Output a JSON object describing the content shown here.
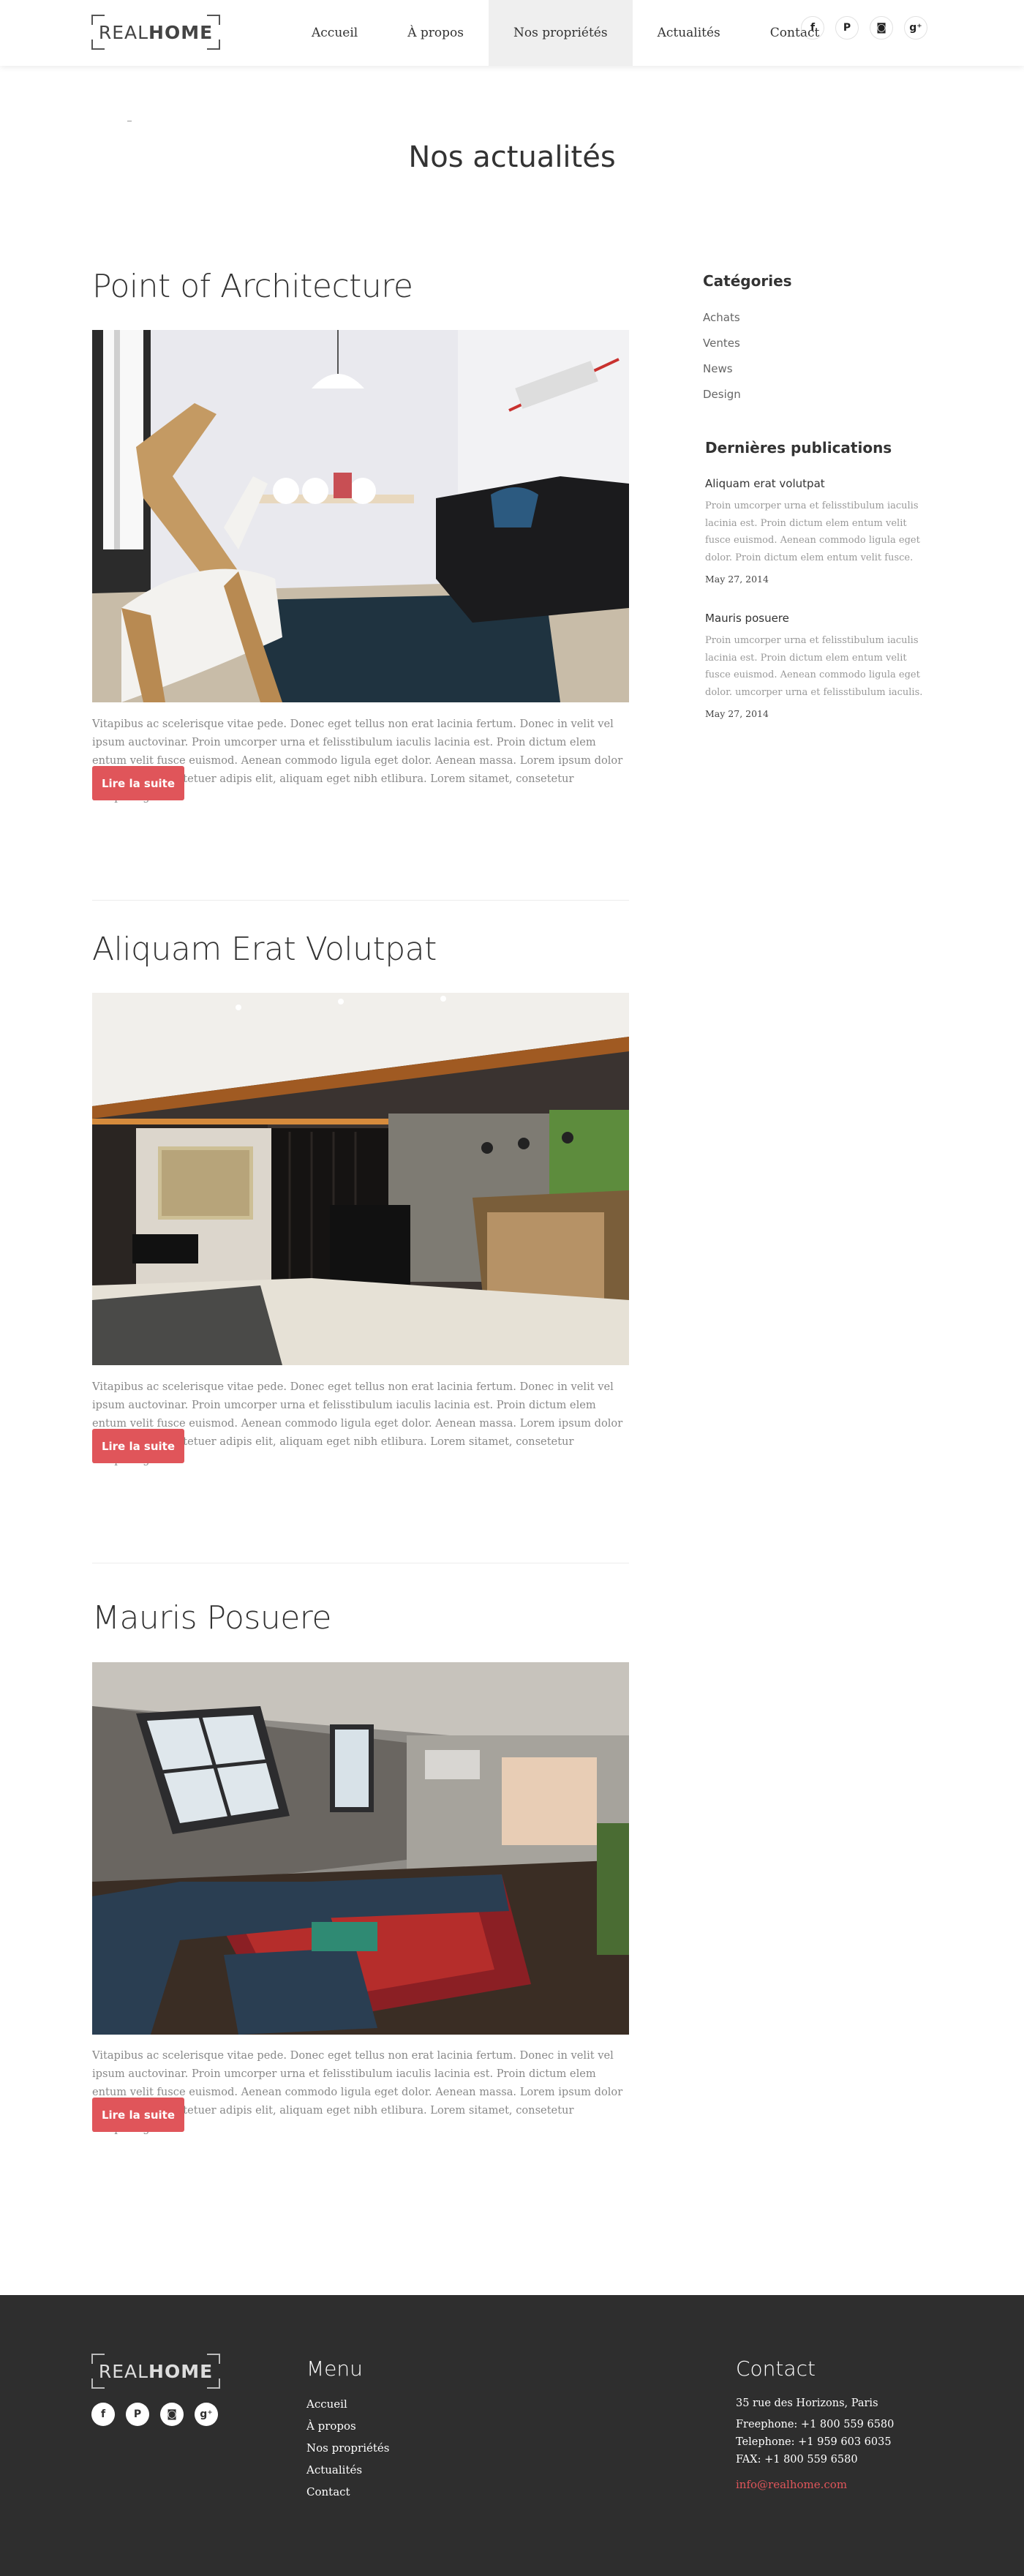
{
  "header": {
    "logo": {
      "light": "REAL",
      "bold": "HOME"
    },
    "nav": [
      "Accueil",
      "À propos",
      "Nos propriétés",
      "Actualités",
      "Contact"
    ],
    "active_nav": "Nos propriétés",
    "social": [
      {
        "icon": "facebook-icon",
        "glyph": "f"
      },
      {
        "icon": "pinterest-icon",
        "glyph": "P"
      },
      {
        "icon": "instagram-icon",
        "glyph": "◙"
      },
      {
        "icon": "google-plus-icon",
        "glyph": "g⁺"
      }
    ]
  },
  "page_title": "Nos actualités",
  "posts": [
    {
      "title": "Point of Architecture",
      "text": "Vitapibus ac scelerisque vitae pede. Donec eget tellus non erat lacinia fertum. Donec in velit vel ipsum auctovinar. Proin umcorper urna et felisstibulum iaculis lacinia est. Proin dictum elem entum velit fusce euismod. Aenean commodo ligula eget dolor. Aenean massa. Lorem ipsum dolor sit amet, consec tetuer adipis elit, aliquam eget nibh etlibura. Lorem sitamet, consetetur sadipscing elitr.",
      "button": "Lire la suite"
    },
    {
      "title": "Aliquam Erat Volutpat",
      "text": "Vitapibus ac scelerisque vitae pede. Donec eget tellus non erat lacinia fertum. Donec in velit vel ipsum auctovinar. Proin umcorper urna et felisstibulum iaculis lacinia est. Proin dictum elem entum velit fusce euismod. Aenean commodo ligula eget dolor. Aenean massa. Lorem ipsum dolor sit amet, consec tetuer adipis elit, aliquam eget nibh etlibura. Lorem sitamet, consetetur sadipscing elitr.",
      "button": "Lire la suite"
    },
    {
      "title": "Mauris Posuere",
      "text": "Vitapibus ac scelerisque vitae pede. Donec eget tellus non erat lacinia fertum. Donec in velit vel ipsum auctovinar. Proin umcorper urna et felisstibulum iaculis lacinia est. Proin dictum elem entum velit fusce euismod. Aenean commodo ligula eget dolor. Aenean massa. Lorem ipsum dolor sit amet, consec tetuer adipis elit, aliquam eget nibh etlibura. Lorem sitamet, consetetur sadipscing elitr.",
      "button": "Lire la suite"
    }
  ],
  "sidebar": {
    "categories_title": "Catégories",
    "categories": [
      "Achats",
      "Ventes",
      "News",
      "Design"
    ],
    "recent_title": "Dernières publications",
    "recent": [
      {
        "title": "Aliquam erat volutpat",
        "text": "Proin umcorper urna et felisstibulum iaculis lacinia est. Proin dictum elem entum velit fusce euismod. Aenean commodo ligula eget dolor. Proin dictum elem entum velit fusce.",
        "date": "May 27, 2014"
      },
      {
        "title": "Mauris posuere",
        "text": "Proin umcorper urna et felisstibulum iaculis lacinia est. Proin dictum elem entum velit fusce euismod. Aenean commodo ligula eget dolor. umcorper urna et felisstibulum iaculis.",
        "date": "May 27, 2014"
      }
    ]
  },
  "footer": {
    "logo": {
      "light": "REAL",
      "bold": "HOME"
    },
    "menu_title": "Menu",
    "menu": [
      "Accueil",
      "À propos",
      "Nos propriétés",
      "Actualités",
      "Contact"
    ],
    "contact_title": "Contact",
    "address": "35 rue des Horizons, Paris",
    "freephone": "Freephone: +1 800 559 6580",
    "telephone": "Telephone: +1 959 603 6035",
    "fax": "FAX: +1 800 559 6580",
    "email": "info@realhome.com"
  },
  "colors": {
    "accent": "#e0555a",
    "footer_bg": "#2e2e2e",
    "active_nav_bg": "#efefef"
  }
}
